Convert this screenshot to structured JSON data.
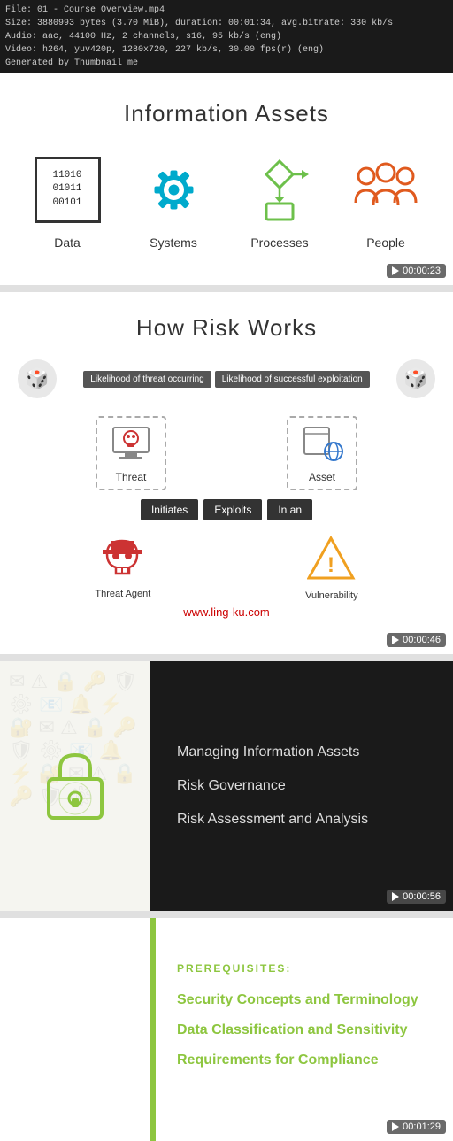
{
  "info_bar": {
    "line1": "File: 01 - Course Overview.mp4",
    "line2": "Size: 3880993 bytes (3.70 MiB), duration: 00:01:34, avg.bitrate: 330 kb/s",
    "line3": "Audio: aac, 44100 Hz, 2 channels, s16, 95 kb/s (eng)",
    "line4": "Video: h264, yuv420p, 1280x720, 227 kb/s, 30.00 fps(r) (eng)",
    "line5": "Generated by Thumbnail me"
  },
  "panel1": {
    "title": "Information Assets",
    "assets": [
      {
        "id": "data",
        "label": "Data",
        "binary": "11010\n01011\n00101"
      },
      {
        "id": "systems",
        "label": "Systems"
      },
      {
        "id": "processes",
        "label": "Processes"
      },
      {
        "id": "people",
        "label": "People"
      }
    ],
    "timestamp": "00:00:23"
  },
  "panel2": {
    "title": "How Risk Works",
    "label1": "Likelihood of threat occurring",
    "label2": "Likelihood of  successful exploitation",
    "threat_label": "Threat",
    "asset_label": "Asset",
    "btn1": "Initiates",
    "btn2": "Exploits",
    "btn3": "In an",
    "threat_agent_label": "Threat Agent",
    "vulnerability_label": "Vulnerability",
    "watermark": "www.ling-ku.com",
    "timestamp": "00:00:46"
  },
  "panel3": {
    "items": [
      "Managing Information Assets",
      "Risk Governance",
      "Risk Assessment and Analysis"
    ],
    "timestamp": "00:00:56"
  },
  "panel4": {
    "prereq_label": "PREREQUISITES:",
    "items": [
      "Security Concepts and Terminology",
      "Data Classification and Sensitivity",
      "Requirements for Compliance"
    ],
    "timestamp": "00:01:29"
  }
}
